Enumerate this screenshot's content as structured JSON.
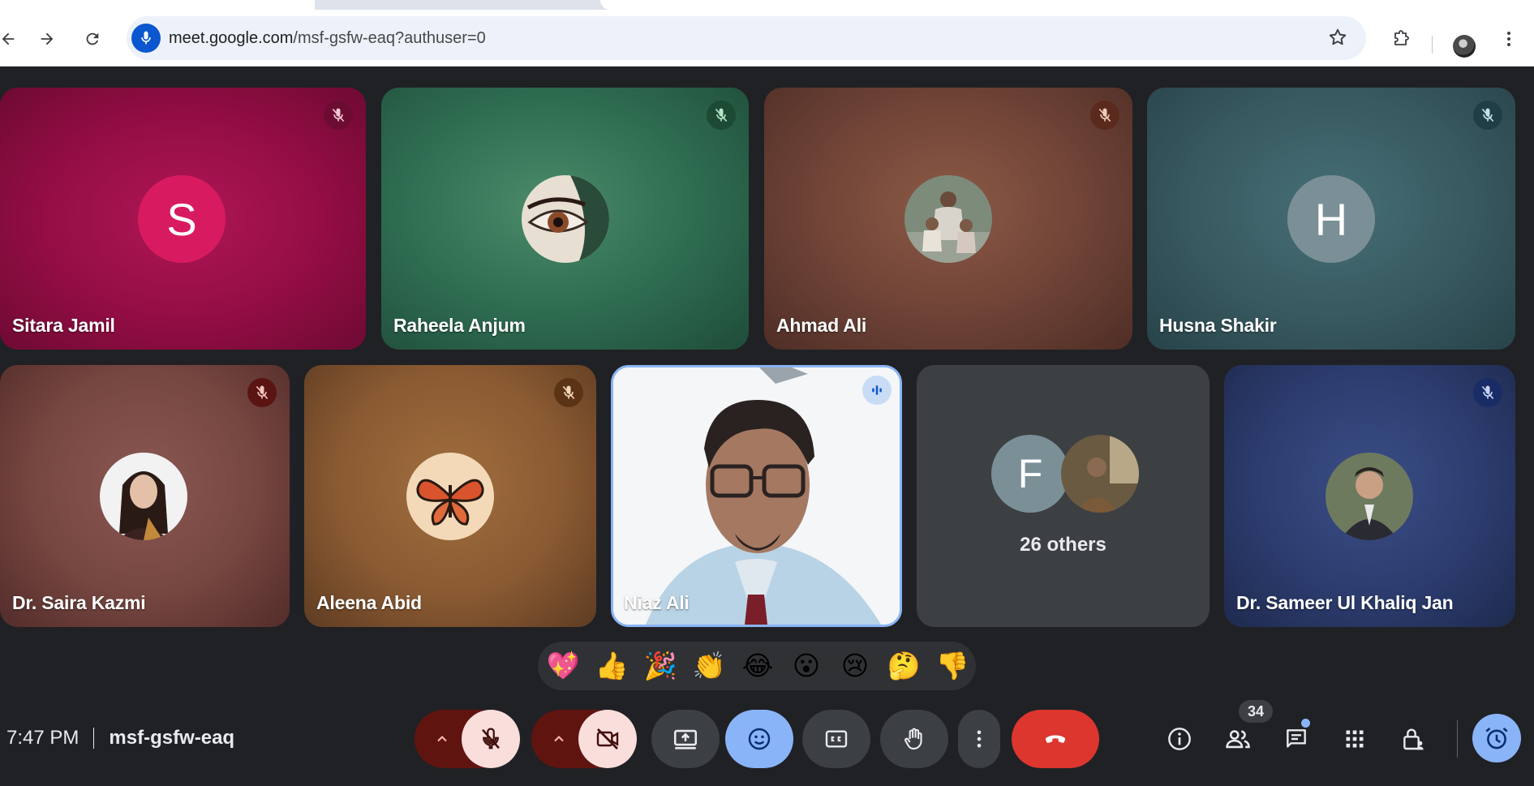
{
  "browser": {
    "url_host": "meet.google.com",
    "url_path": "/msf-gsfw-eaq?authuser=0"
  },
  "tiles": {
    "sitara": {
      "name": "Sitara Jamil",
      "initial": "S",
      "bg": "#a50e45",
      "avatar_color": "#c2185b",
      "muted": true
    },
    "raheela": {
      "name": "Raheela Anjum",
      "bg": "#2e6b4f",
      "muted": true
    },
    "ahmad": {
      "name": "Ahmad Ali",
      "bg": "#7a4a3a",
      "muted": true
    },
    "husna": {
      "name": "Husna Shakir",
      "initial": "H",
      "bg": "#36585f",
      "avatar_color": "#7b8f97",
      "muted": true
    },
    "saira": {
      "name": "Dr. Saira Kazmi",
      "bg": "#7a4742",
      "muted": true
    },
    "aleena": {
      "name": "Aleena Abid",
      "bg": "#8a5a32",
      "muted": true
    },
    "niaz": {
      "name": "Niaz Ali",
      "speaking": true
    },
    "others": {
      "initial": "F",
      "label": "26 others"
    },
    "sameer": {
      "name": "Dr. Sameer Ul Khaliq Jan",
      "bg": "#2b3b6b",
      "muted": true
    }
  },
  "reactions": [
    "💖",
    "👍",
    "🎉",
    "👏",
    "😂",
    "😮",
    "😢",
    "🤔",
    "👎"
  ],
  "meeting": {
    "time": "7:47 PM",
    "code": "msf-gsfw-eaq",
    "people_count": "34"
  },
  "colors": {
    "meet_bg": "#202124",
    "leave_red": "#dc362e",
    "active_blue": "#8ab4f8",
    "muted_red_bg": "#f9dedc"
  }
}
